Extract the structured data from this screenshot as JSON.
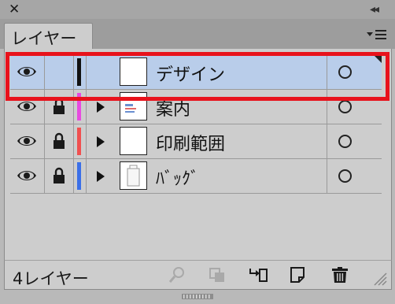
{
  "panel": {
    "close_glyph": "✕",
    "collapse_glyph": "◂◂",
    "tab_label": "レイヤー",
    "menu_icon": "panel-menu-icon"
  },
  "layers": [
    {
      "name": "デザイン",
      "color": "#111111",
      "selected": true,
      "locked": false,
      "expandable": false
    },
    {
      "name": "案内",
      "color": "#e84be0",
      "selected": false,
      "locked": true,
      "expandable": true
    },
    {
      "name": "印刷範囲",
      "color": "#f05050",
      "selected": false,
      "locked": true,
      "expandable": true
    },
    {
      "name": "ﾊﾞｯｸﾞ",
      "color": "#3b6fe8",
      "selected": false,
      "locked": true,
      "expandable": true
    }
  ],
  "footer": {
    "count_label": "4レイヤー",
    "icons": [
      "locate-object-icon",
      "make-clipping-mask-icon",
      "create-sublayer-icon",
      "create-new-layer-icon",
      "delete-icon"
    ]
  },
  "colors": {
    "highlight": "#e8121b",
    "selected_row": "#b9cdea"
  }
}
